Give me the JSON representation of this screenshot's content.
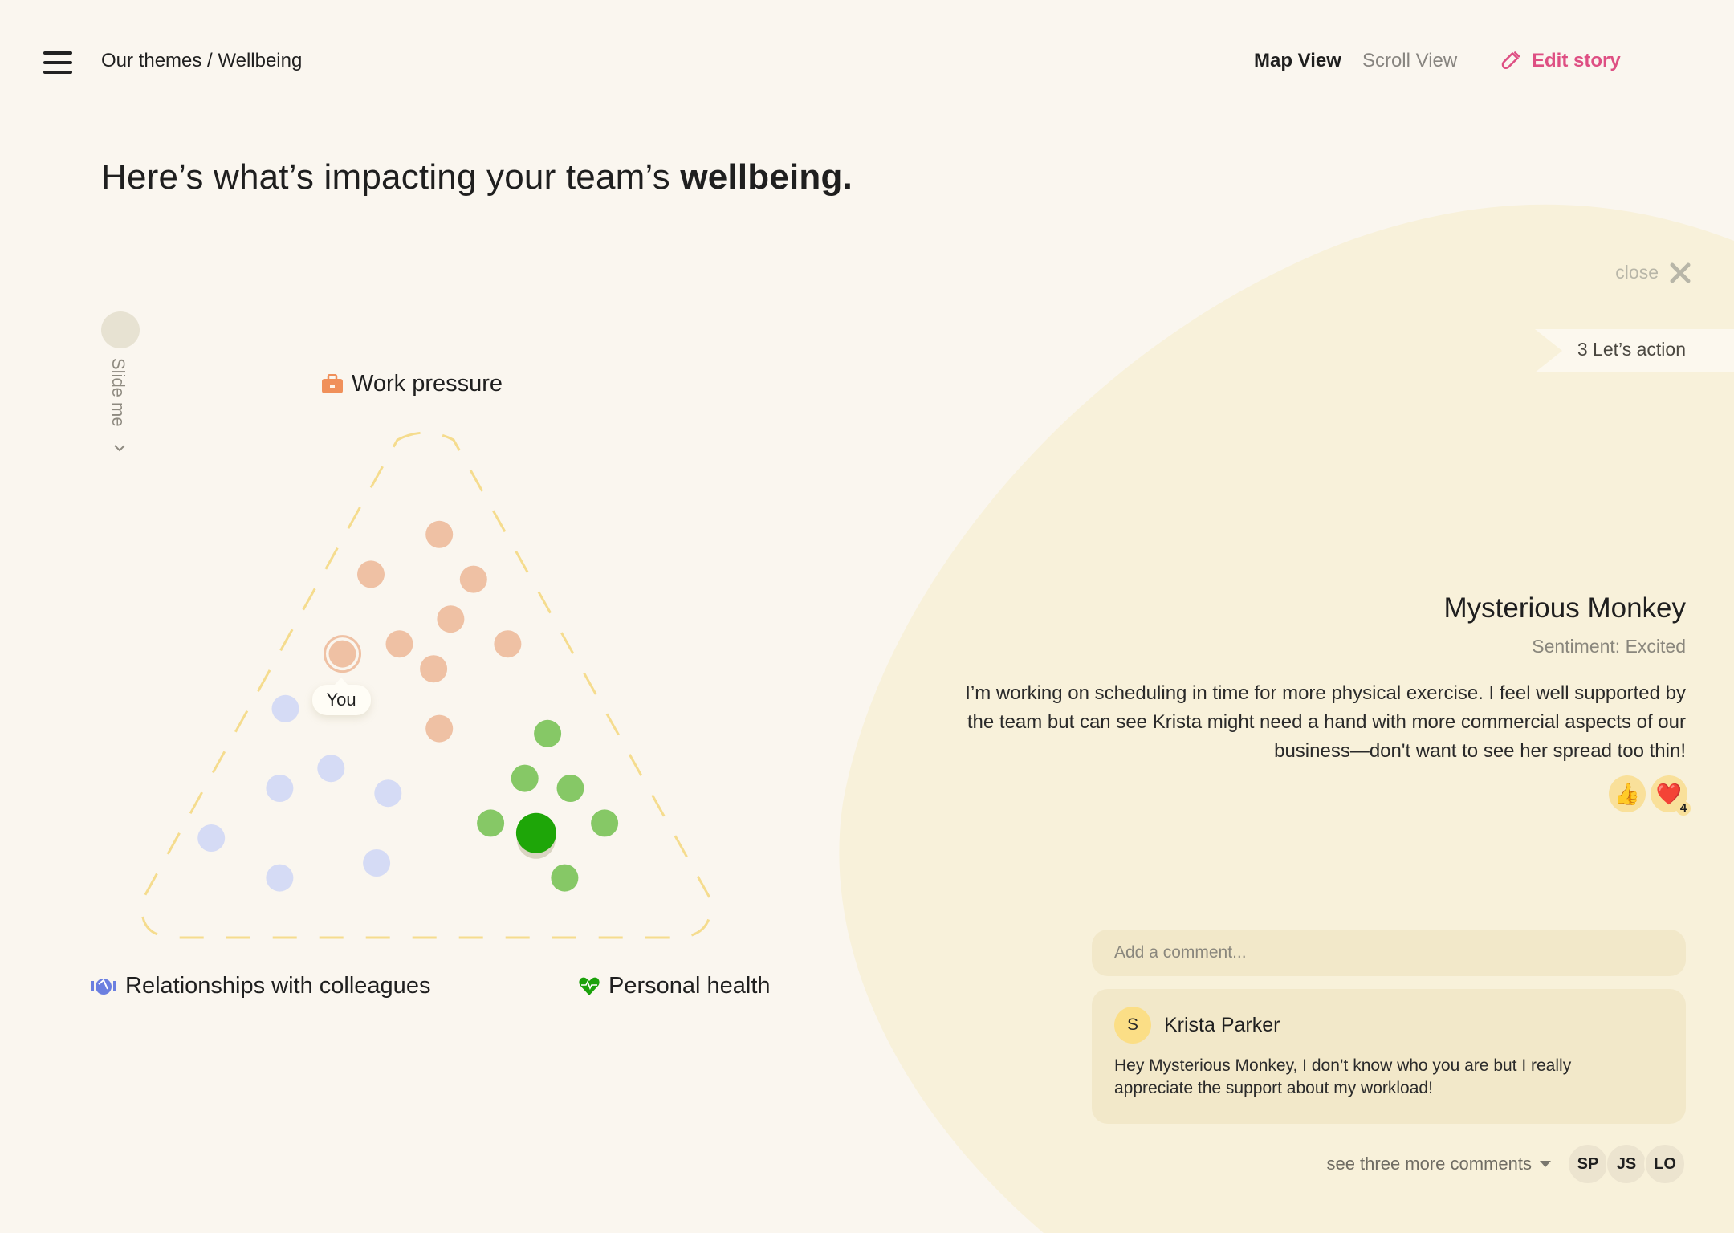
{
  "header": {
    "breadcrumb": "Our themes / Wellbeing",
    "tabs": [
      {
        "label": "Map View",
        "active": true
      },
      {
        "label": "Scroll View",
        "active": false
      }
    ],
    "edit_story_label": "Edit story"
  },
  "headline": {
    "prefix": "Here’s what’s impacting your team’s ",
    "emphasis": "wellbeing."
  },
  "slider": {
    "label": "Slide me"
  },
  "map": {
    "axes": {
      "top": {
        "label": "Work pressure",
        "icon": "briefcase-icon",
        "color": "#f0905a"
      },
      "bottom_left": {
        "label": "Relationships with colleagues",
        "icon": "handshake-icon",
        "color": "#6b7fe0"
      },
      "bottom_right": {
        "label": "Personal health",
        "icon": "heart-pulse-icon",
        "color": "#1aa10a"
      }
    },
    "you_label": "You",
    "colors": {
      "work": "#efc1a4",
      "relationships": "#d5dbf5",
      "health": "#86c866",
      "selected": "#1ea608",
      "triangle_dash": "#f5dc8e"
    },
    "points": [
      {
        "group": "work",
        "x": 0.52,
        "y": 0.19
      },
      {
        "group": "work",
        "x": 0.4,
        "y": 0.27
      },
      {
        "group": "work",
        "x": 0.58,
        "y": 0.28
      },
      {
        "group": "work",
        "x": 0.54,
        "y": 0.36
      },
      {
        "group": "work",
        "x": 0.45,
        "y": 0.41
      },
      {
        "group": "work",
        "x": 0.64,
        "y": 0.41
      },
      {
        "group": "work",
        "x": 0.51,
        "y": 0.46
      },
      {
        "group": "work",
        "x": 0.35,
        "y": 0.43,
        "you": true
      },
      {
        "group": "work",
        "x": 0.52,
        "y": 0.58
      },
      {
        "group": "relationships",
        "x": 0.25,
        "y": 0.54
      },
      {
        "group": "relationships",
        "x": 0.33,
        "y": 0.66
      },
      {
        "group": "relationships",
        "x": 0.24,
        "y": 0.7
      },
      {
        "group": "relationships",
        "x": 0.43,
        "y": 0.71
      },
      {
        "group": "relationships",
        "x": 0.12,
        "y": 0.8
      },
      {
        "group": "relationships",
        "x": 0.24,
        "y": 0.88
      },
      {
        "group": "relationships",
        "x": 0.41,
        "y": 0.85
      },
      {
        "group": "health",
        "x": 0.71,
        "y": 0.59
      },
      {
        "group": "health",
        "x": 0.67,
        "y": 0.68
      },
      {
        "group": "health",
        "x": 0.75,
        "y": 0.7
      },
      {
        "group": "health",
        "x": 0.61,
        "y": 0.77
      },
      {
        "group": "health",
        "x": 0.81,
        "y": 0.77
      },
      {
        "group": "health",
        "x": 0.74,
        "y": 0.88
      },
      {
        "group": "selected",
        "x": 0.69,
        "y": 0.79,
        "selected": true
      }
    ]
  },
  "panel": {
    "close_label": "close",
    "action_badge": "3 Let’s action",
    "story_title": "Mysterious Monkey",
    "sentiment": "Sentiment: Excited",
    "story_body": "I’m working on scheduling in time for more physical exercise. I feel well supported by the team but can see Krista might need a hand with more commercial aspects of our business—don't want to see her spread too thin!",
    "reactions": [
      {
        "emoji": "👍",
        "name": "thumbs-up-icon",
        "count": null
      },
      {
        "emoji": "❤️",
        "name": "heart-icon",
        "count": "4"
      }
    ],
    "comment_placeholder": "Add a comment...",
    "comments": [
      {
        "avatar_initial": "S",
        "author": "Krista Parker",
        "body": "Hey Mysterious Monkey, I don’t know who you are but I really appreciate the support about my workload!"
      }
    ],
    "more_comments_label": "see three more comments",
    "more_avatars": [
      "SP",
      "JS",
      "LO"
    ]
  },
  "colors": {
    "background": "#faf6ef",
    "panel_blob": "#f8f1da",
    "accent_pink": "#de4f83"
  }
}
